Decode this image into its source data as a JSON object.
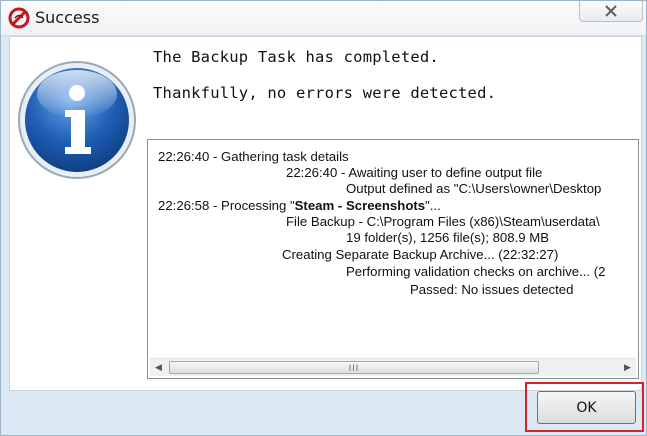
{
  "window": {
    "title": "Success",
    "close_label": "✕"
  },
  "icons": {
    "app": "app-logo-icon",
    "main": "info-icon",
    "close": "close-icon"
  },
  "message": {
    "line1": "The Backup Task has completed.",
    "line2": "Thankfully, no errors were detected."
  },
  "log": {
    "lines": [
      {
        "text": "22:26:40 - Gathering task details"
      },
      {
        "text": "22:26:40 - Awaiting user to define output file"
      },
      {
        "text": "Output defined as \"C:\\Users\\owner\\Desktop"
      },
      {
        "pre": "22:26:58 - Processing \"",
        "bold": "Steam - Screenshots",
        "post": "\"..."
      },
      {
        "text": "File Backup - C:\\Program Files (x86)\\Steam\\userdata\\"
      },
      {
        "text": "19 folder(s), 1256 file(s); 808.9 MB"
      },
      {
        "text": "Creating Separate Backup Archive... (22:32:27)"
      },
      {
        "text": "Performing validation checks on archive... (2"
      },
      {
        "text": "Passed: No issues detected"
      }
    ],
    "scroll_left": "◀",
    "scroll_right": "▶",
    "scroll_grip": "III"
  },
  "buttons": {
    "ok": "OK"
  },
  "colors": {
    "dialog_background": "#dbe9f5",
    "highlight": "#d8232a"
  }
}
